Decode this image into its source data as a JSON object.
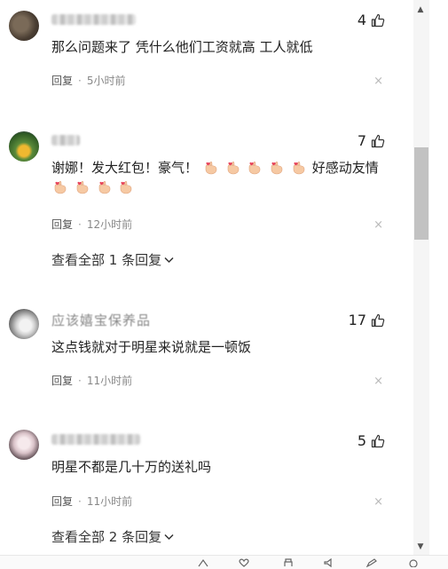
{
  "comments": [
    {
      "text": "那么问题来了 凭什么他们工资就高 工人就低",
      "likes": "4",
      "reply_label": "回复",
      "dot": "·",
      "time": "5小时前",
      "close": "×"
    },
    {
      "text_main": "谢娜！发大红包！豪气！",
      "text_tail": "好感动友情",
      "likes": "7",
      "reply_label": "回复",
      "dot": "·",
      "time": "12小时前",
      "close": "×",
      "view_replies": "查看全部 1 条回复"
    },
    {
      "name": "应该嬉宝保养品",
      "text": "这点钱就对于明星来说就是一顿饭",
      "likes": "17",
      "reply_label": "回复",
      "dot": "·",
      "time": "11小时前",
      "close": "×"
    },
    {
      "text": "明星不都是几十万的送礼吗",
      "likes": "5",
      "reply_label": "回复",
      "dot": "·",
      "time": "11小时前",
      "close": "×",
      "view_replies": "查看全部 2 条回复"
    }
  ],
  "scrollbar": {
    "up": "▲",
    "down": "▼"
  },
  "icons": [
    "thumbs-up-icon",
    "close-icon",
    "chevron-down-icon",
    "finger-heart-emoji",
    "scroll-up-icon",
    "scroll-down-icon"
  ]
}
